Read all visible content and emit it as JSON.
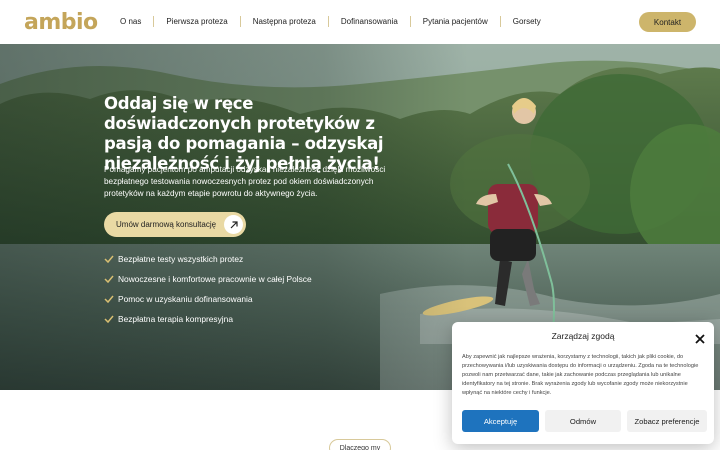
{
  "header": {
    "logo_text": "ambio",
    "nav": [
      {
        "label": "O nas"
      },
      {
        "label": "Pierwsza proteza"
      },
      {
        "label": "Następna proteza"
      },
      {
        "label": "Dofinansowania"
      },
      {
        "label": "Pytania pacjentów"
      },
      {
        "label": "Gorsety"
      }
    ],
    "contact_label": "Kontakt"
  },
  "hero": {
    "title": "Oddaj się w ręce doświadczonych protetyków z pasją do pomagania – odzyskaj niezależność i żyj pełnią życia!",
    "description": "Pomagamy pacjentom po amputacji odzyskać niezależność dzięki możliwości bezpłatnego testowania nowoczesnych protez pod okiem doświadczonych protetyków na każdym etapie powrotu do aktywnego życia.",
    "cta_label": "Umów darmową konsultację",
    "features": [
      {
        "label": "Bezpłatne testy wszystkich protez"
      },
      {
        "label": "Nowoczesne i komfortowe pracownie w całej Polsce"
      },
      {
        "label": "Pomoc w uzyskaniu dofinansowania"
      },
      {
        "label": "Bezpłatna terapia kompresyjna"
      }
    ]
  },
  "section": {
    "pill_label": "Dlaczego my"
  },
  "cookie": {
    "title": "Zarządzaj zgodą",
    "body": "Aby zapewnić jak najlepsze wrażenia, korzystamy z technologii, takich jak pliki cookie, do przechowywania i/lub uzyskiwania dostępu do informacji o urządzeniu. Zgoda na te technologie pozwoli nam przetwarzać dane, takie jak zachowanie podczas przeglądania lub unikalne identyfikatory na tej stronie. Brak wyrażenia zgody lub wycofanie zgody może niekorzystnie wpłynąć na niektóre cechy i funkcje.",
    "accept_label": "Akceptuję",
    "deny_label": "Odmów",
    "prefs_label": "Zobacz preferencje"
  },
  "colors": {
    "brand_gold": "#cdb56b",
    "cta_bg": "#e9d9a4",
    "accept_blue": "#1e73be",
    "check_gold": "#d9bf72"
  }
}
